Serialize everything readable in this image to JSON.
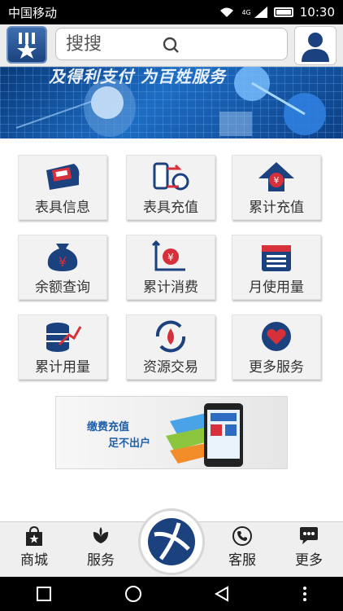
{
  "status_bar": {
    "carrier": "中国移动",
    "network": "4G",
    "time": "10:30"
  },
  "header": {
    "search_placeholder": "搜搜",
    "icons": [
      "logo-icon",
      "search-icon",
      "user-icon"
    ]
  },
  "banner": {
    "text": "及得利支付 为百姓服务"
  },
  "grid": {
    "items": [
      {
        "label": "表具信息",
        "icon": "meter-info-icon"
      },
      {
        "label": "表具充值",
        "icon": "meter-recharge-icon"
      },
      {
        "label": "累计充值",
        "icon": "cumulative-recharge-icon"
      },
      {
        "label": "余额查询",
        "icon": "balance-query-icon"
      },
      {
        "label": "累计消费",
        "icon": "cumulative-consumption-icon"
      },
      {
        "label": "月使用量",
        "icon": "monthly-usage-icon"
      },
      {
        "label": "累计用量",
        "icon": "cumulative-usage-icon"
      },
      {
        "label": "资源交易",
        "icon": "resource-trade-icon"
      },
      {
        "label": "更多服务",
        "icon": "more-services-icon"
      }
    ]
  },
  "promo": {
    "line1": "缴费充值",
    "line2": "足不出户"
  },
  "bottom_nav": {
    "items": [
      {
        "label": "商城",
        "icon": "shop-bag-icon"
      },
      {
        "label": "服务",
        "icon": "flower-icon"
      },
      {
        "label": "客服",
        "icon": "phone-icon"
      },
      {
        "label": "更多",
        "icon": "chat-more-icon"
      }
    ]
  },
  "colors": {
    "brand_blue": "#1b427f",
    "accent_red": "#d6303a",
    "nav_bg": "#efefef"
  }
}
